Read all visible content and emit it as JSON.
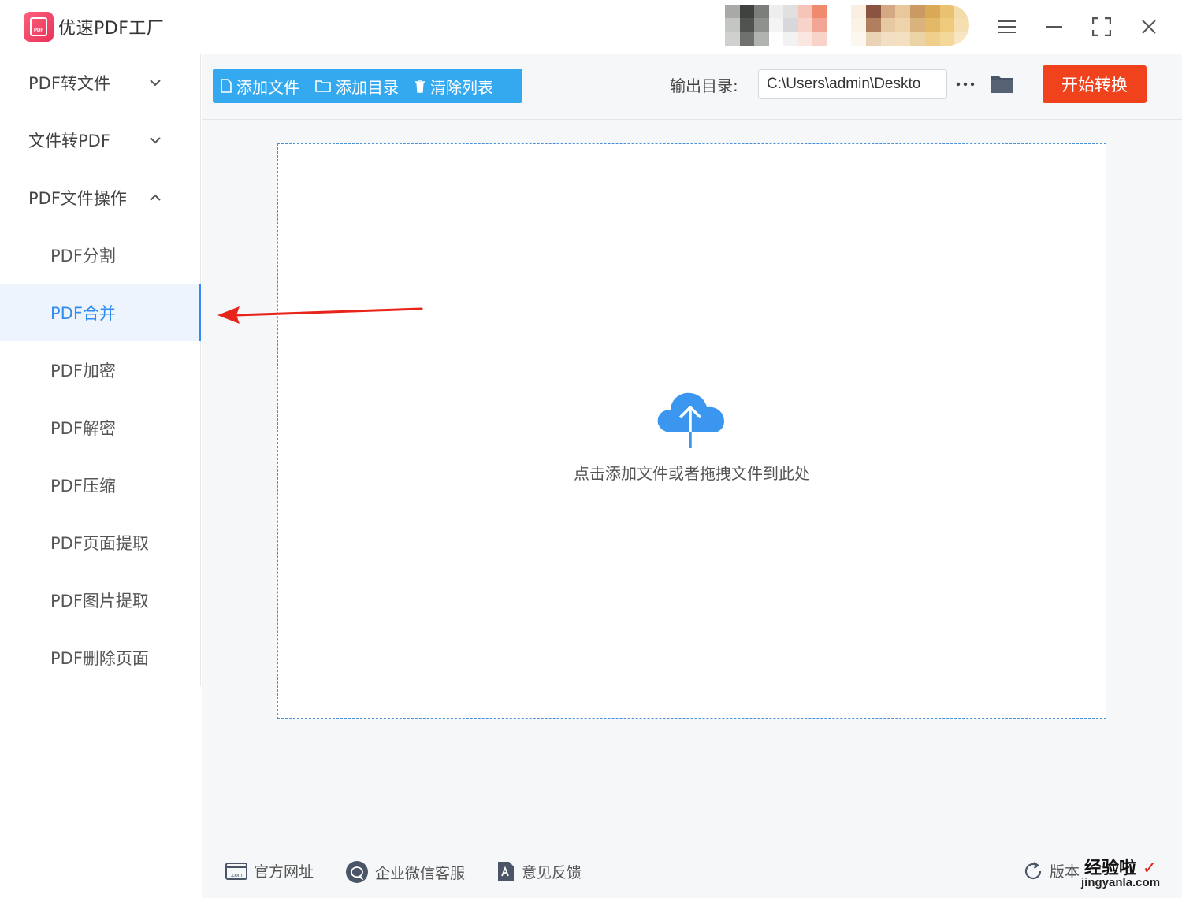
{
  "app": {
    "title": "优速PDF工厂",
    "logo_text": "PDF"
  },
  "sidebar": {
    "groups": [
      {
        "label": "PDF转文件",
        "expanded": false
      },
      {
        "label": "文件转PDF",
        "expanded": false
      },
      {
        "label": "PDF文件操作",
        "expanded": true
      }
    ],
    "sub_items": [
      {
        "label": "PDF分割",
        "active": false
      },
      {
        "label": "PDF合并",
        "active": true
      },
      {
        "label": "PDF加密",
        "active": false
      },
      {
        "label": "PDF解密",
        "active": false
      },
      {
        "label": "PDF压缩",
        "active": false
      },
      {
        "label": "PDF页面提取",
        "active": false
      },
      {
        "label": "PDF图片提取",
        "active": false
      },
      {
        "label": "PDF删除页面",
        "active": false
      }
    ]
  },
  "toolbar": {
    "add_file": "添加文件",
    "add_dir": "添加目录",
    "clear_list": "清除列表",
    "output_label": "输出目录:",
    "output_path": "C:\\Users\\admin\\Deskto",
    "start": "开始转换"
  },
  "dropzone": {
    "hint": "点击添加文件或者拖拽文件到此处"
  },
  "footer": {
    "website": "官方网址",
    "wechat": "企业微信客服",
    "feedback": "意见反馈",
    "version": "版本"
  },
  "watermark": {
    "text": "经验啦",
    "url": "jingyanla.com"
  },
  "colors": {
    "accent_blue": "#2f8cf0",
    "toolbar_blue": "#35a9f0",
    "start_red": "#f0421c",
    "annotation_red": "#e8231a"
  }
}
